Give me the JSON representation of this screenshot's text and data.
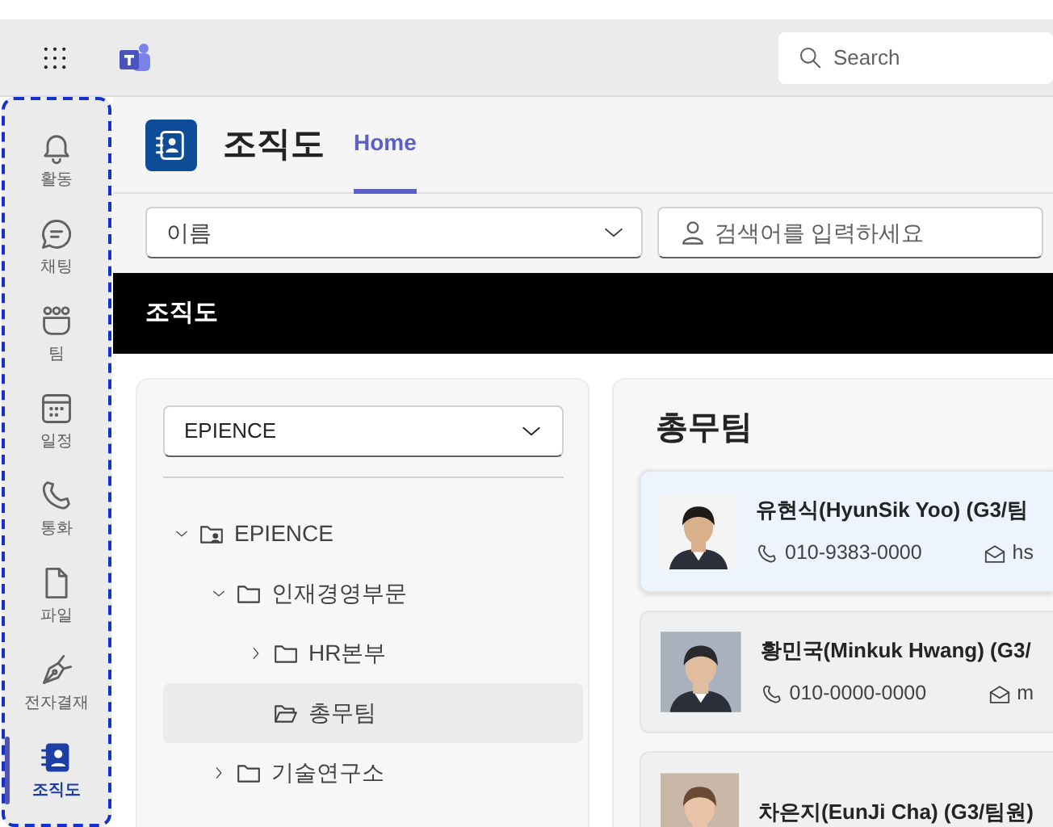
{
  "top_bar": {
    "search": {
      "placeholder": "Search"
    }
  },
  "nav_rail": [
    {
      "label": "활동",
      "kind": "bell",
      "selected": false
    },
    {
      "label": "채팅",
      "kind": "chat",
      "selected": false
    },
    {
      "label": "팀",
      "kind": "team",
      "selected": false
    },
    {
      "label": "일정",
      "kind": "calendar",
      "selected": false
    },
    {
      "label": "통화",
      "kind": "phone",
      "selected": false
    },
    {
      "label": "파일",
      "kind": "file",
      "selected": false
    },
    {
      "label": "전자결재",
      "kind": "pen",
      "selected": false
    },
    {
      "label": "조직도",
      "kind": "contacts",
      "selected": true
    }
  ],
  "app": {
    "title": "조직도",
    "tabs": [
      {
        "label": "Home",
        "selected": true
      }
    ]
  },
  "filters": {
    "field_select": {
      "value": "이름"
    },
    "search": {
      "placeholder": "검색어를 입력하세요"
    }
  },
  "banner": {
    "title": "조직도"
  },
  "tree_panel": {
    "company_select": {
      "value": "EPIENCE"
    },
    "tree": [
      {
        "label": "EPIENCE",
        "kind": "company",
        "expandable": true,
        "expanded": true,
        "selected": false,
        "children": [
          {
            "label": "인재경영부문",
            "kind": "folder",
            "expandable": true,
            "expanded": true,
            "selected": false,
            "children": [
              {
                "label": "HR본부",
                "kind": "folder",
                "expandable": true,
                "expanded": false,
                "selected": false
              },
              {
                "label": "총무팀",
                "kind": "folder",
                "expandable": false,
                "selected": true
              }
            ]
          },
          {
            "label": "기술연구소",
            "kind": "folder",
            "expandable": true,
            "expanded": false,
            "selected": false
          }
        ]
      }
    ]
  },
  "detail": {
    "title": "총무팀",
    "members": [
      {
        "name": "유현식(HyunSik Yoo) (G3/팀",
        "phone": "010-9383-0000",
        "email": "hs",
        "selected": true
      },
      {
        "name": "황민국(Minkuk Hwang) (G3/",
        "phone": "010-0000-0000",
        "email": "m",
        "selected": false
      },
      {
        "name": "차은지(EunJi Cha) (G3/팀원)",
        "selected": false
      }
    ]
  }
}
